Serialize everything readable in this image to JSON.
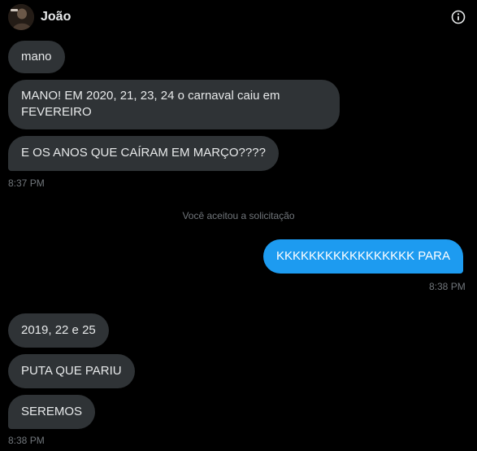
{
  "header": {
    "contact_name": "João",
    "avatar_icon": "profile-photo",
    "info_icon": "info-icon"
  },
  "colors": {
    "background": "#000000",
    "incoming_bubble": "#2f3336",
    "outgoing_bubble": "#1d9bf0",
    "text": "#e7e9ea",
    "muted": "#71767b"
  },
  "messages": [
    {
      "direction": "incoming",
      "text": "mano"
    },
    {
      "direction": "incoming",
      "text": "MANO! EM 2020, 21, 23, 24 o carnaval caiu em FEVEREIRO"
    },
    {
      "direction": "incoming",
      "text": "E OS ANOS QUE CAÍRAM EM MARÇO????"
    },
    {
      "direction": "timestamp",
      "text": "8:37 PM"
    },
    {
      "direction": "system",
      "text": "Você aceitou a solicitação"
    },
    {
      "direction": "outgoing",
      "text": "KKKKKKKKKKKKKKKKK PARA"
    },
    {
      "direction": "timestamp",
      "text": "8:38 PM"
    },
    {
      "direction": "incoming",
      "text": "2019, 22 e 25"
    },
    {
      "direction": "incoming",
      "text": "PUTA QUE PARIU"
    },
    {
      "direction": "incoming",
      "text": "SEREMOS"
    },
    {
      "direction": "timestamp",
      "text": "8:38 PM"
    }
  ]
}
